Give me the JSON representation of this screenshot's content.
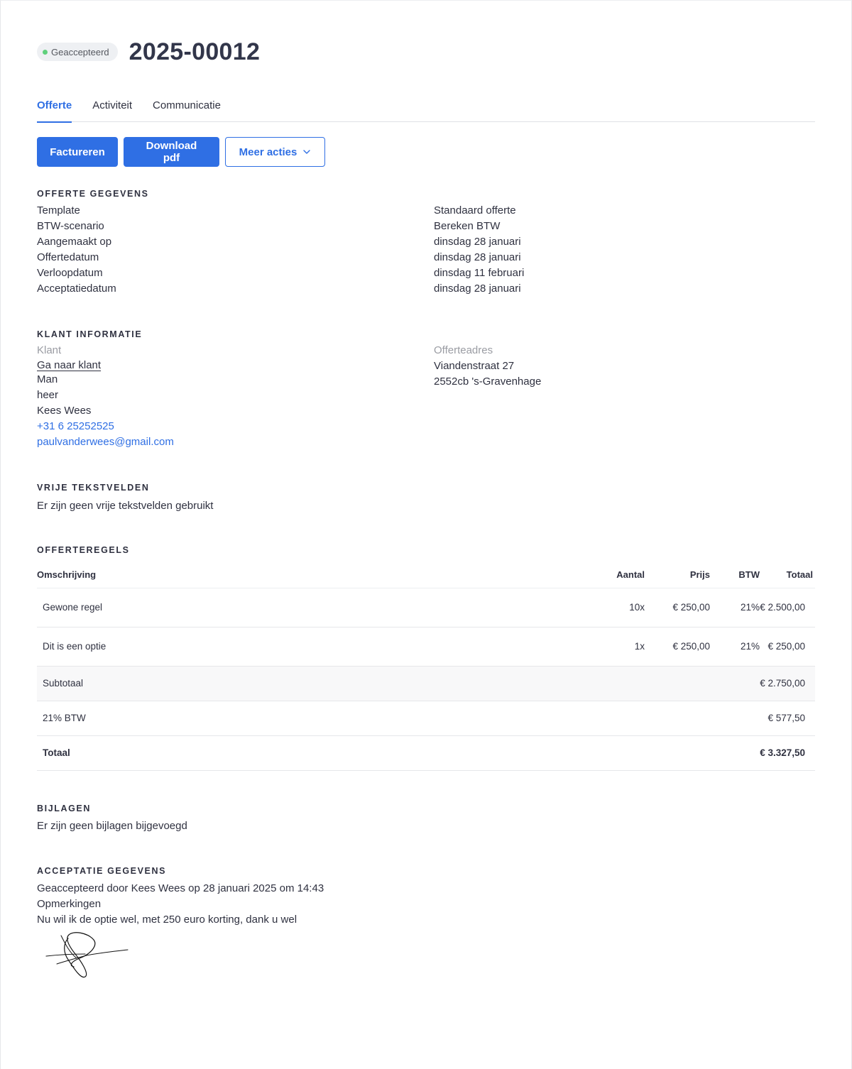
{
  "header": {
    "status": "Geaccepteerd",
    "status_color": "#5fd07c",
    "number": "2025-00012"
  },
  "tabs": [
    {
      "label": "Offerte",
      "active": true
    },
    {
      "label": "Activiteit",
      "active": false
    },
    {
      "label": "Communicatie",
      "active": false
    }
  ],
  "actions": {
    "invoice": "Factureren",
    "download": "Download pdf",
    "more": "Meer acties"
  },
  "offerte": {
    "title": "Offerte gegevens",
    "rows": [
      {
        "label": "Template",
        "value": "Standaard offerte"
      },
      {
        "label": "BTW-scenario",
        "value": "Bereken BTW"
      },
      {
        "label": "Aangemaakt op",
        "value": "dinsdag 28 januari"
      },
      {
        "label": "Offertedatum",
        "value": "dinsdag 28 januari"
      },
      {
        "label": "Verloopdatum",
        "value": "dinsdag 11 februari"
      },
      {
        "label": "Acceptatiedatum",
        "value": "dinsdag 28 januari"
      }
    ]
  },
  "klant": {
    "title": "Klant informatie",
    "label": "Klant",
    "link": "Ga naar klant",
    "gender": "Man",
    "salutation": "heer",
    "name": "Kees Wees",
    "phone": "+31 6 25252525",
    "email": "paulvanderwees@gmail.com",
    "address_label": "Offerteadres",
    "street": "Viandenstraat 27",
    "city": "2552cb 's-Gravenhage"
  },
  "vrij": {
    "title": "Vrije tekstvelden",
    "text": "Er zijn geen vrije tekstvelden gebruikt"
  },
  "regels": {
    "title": "Offerteregels",
    "columns": {
      "desc": "Omschrijving",
      "qty": "Aantal",
      "price": "Prijs",
      "vat": "BTW",
      "total": "Totaal"
    },
    "lines": [
      {
        "desc": "Gewone regel",
        "qty": "10x",
        "price": "€ 250,00",
        "vat": "21%",
        "total": "€ 2.500,00"
      },
      {
        "desc": "Dit is een optie",
        "qty": "1x",
        "price": "€ 250,00",
        "vat": "21%",
        "total": "€ 250,00"
      }
    ],
    "subtotal_label": "Subtotaal",
    "subtotal": "€ 2.750,00",
    "vat_label": "21% BTW",
    "vat": "€ 577,50",
    "total_label": "Totaal",
    "total": "€ 3.327,50"
  },
  "bijlagen": {
    "title": "Bijlagen",
    "text": "Er zijn geen bijlagen bijgevoegd"
  },
  "acceptatie": {
    "title": "Acceptatie gegevens",
    "accepted_by": "Geaccepteerd door Kees Wees op 28 januari 2025 om 14:43",
    "remarks_label": "Opmerkingen",
    "remarks": "Nu wil ik de optie wel, met 250 euro korting, dank u wel"
  },
  "colors": {
    "accent": "#2f6fe4",
    "text": "#2f3140",
    "muted": "#9a9ca3"
  }
}
